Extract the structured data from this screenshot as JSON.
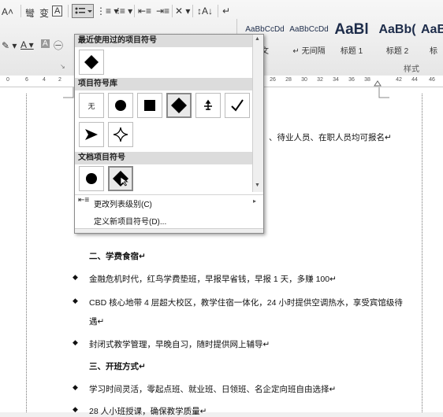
{
  "ribbon": {
    "styles": [
      {
        "sample": "AaBbCcDd",
        "label": "文"
      },
      {
        "sample": "AaBbCcDd",
        "label": "↵ 无间隔"
      },
      {
        "sample": "AaBl",
        "label": "标题 1"
      },
      {
        "sample": "AaBb(",
        "label": "标题 2"
      },
      {
        "sample": "AaB",
        "label": "标"
      }
    ],
    "styles_group_label": "样式"
  },
  "ruler": {
    "ticks": [
      "0",
      "6",
      "4",
      "2",
      "26",
      "28",
      "30",
      "32",
      "34",
      "36",
      "38",
      "42",
      "44",
      "46"
    ]
  },
  "dropdown": {
    "recent_header": "最近使用过的项目符号",
    "library_header": "项目符号库",
    "library_none": "无",
    "document_header": "文档项目符号",
    "change_level": "更改列表级别(C)",
    "define_new": "定义新项目符号(D)..."
  },
  "document": {
    "top_fragment": "、待业人员、在职人员均可报名↵",
    "heading2": "二、学费食宿↵",
    "bullet1": "金融危机时代，红鸟学费垫班，早报早省钱，早报 1 天，多赚 100↵",
    "bullet2a": "CBD 核心地带 4 层超大校区，教学住宿一体化，24 小时提供空调热水，享受宾馆级待",
    "bullet2b": "遇↵",
    "bullet3": "封闭式教学管理，早晚自习，随时提供网上辅导↵",
    "heading3": "三、开班方式↵",
    "bullet4": "学习时间灵活，零起点班、就业班、日领班、名企定向班自由选择↵",
    "bullet5": "28 人小班授课，确保教学质量↵"
  }
}
